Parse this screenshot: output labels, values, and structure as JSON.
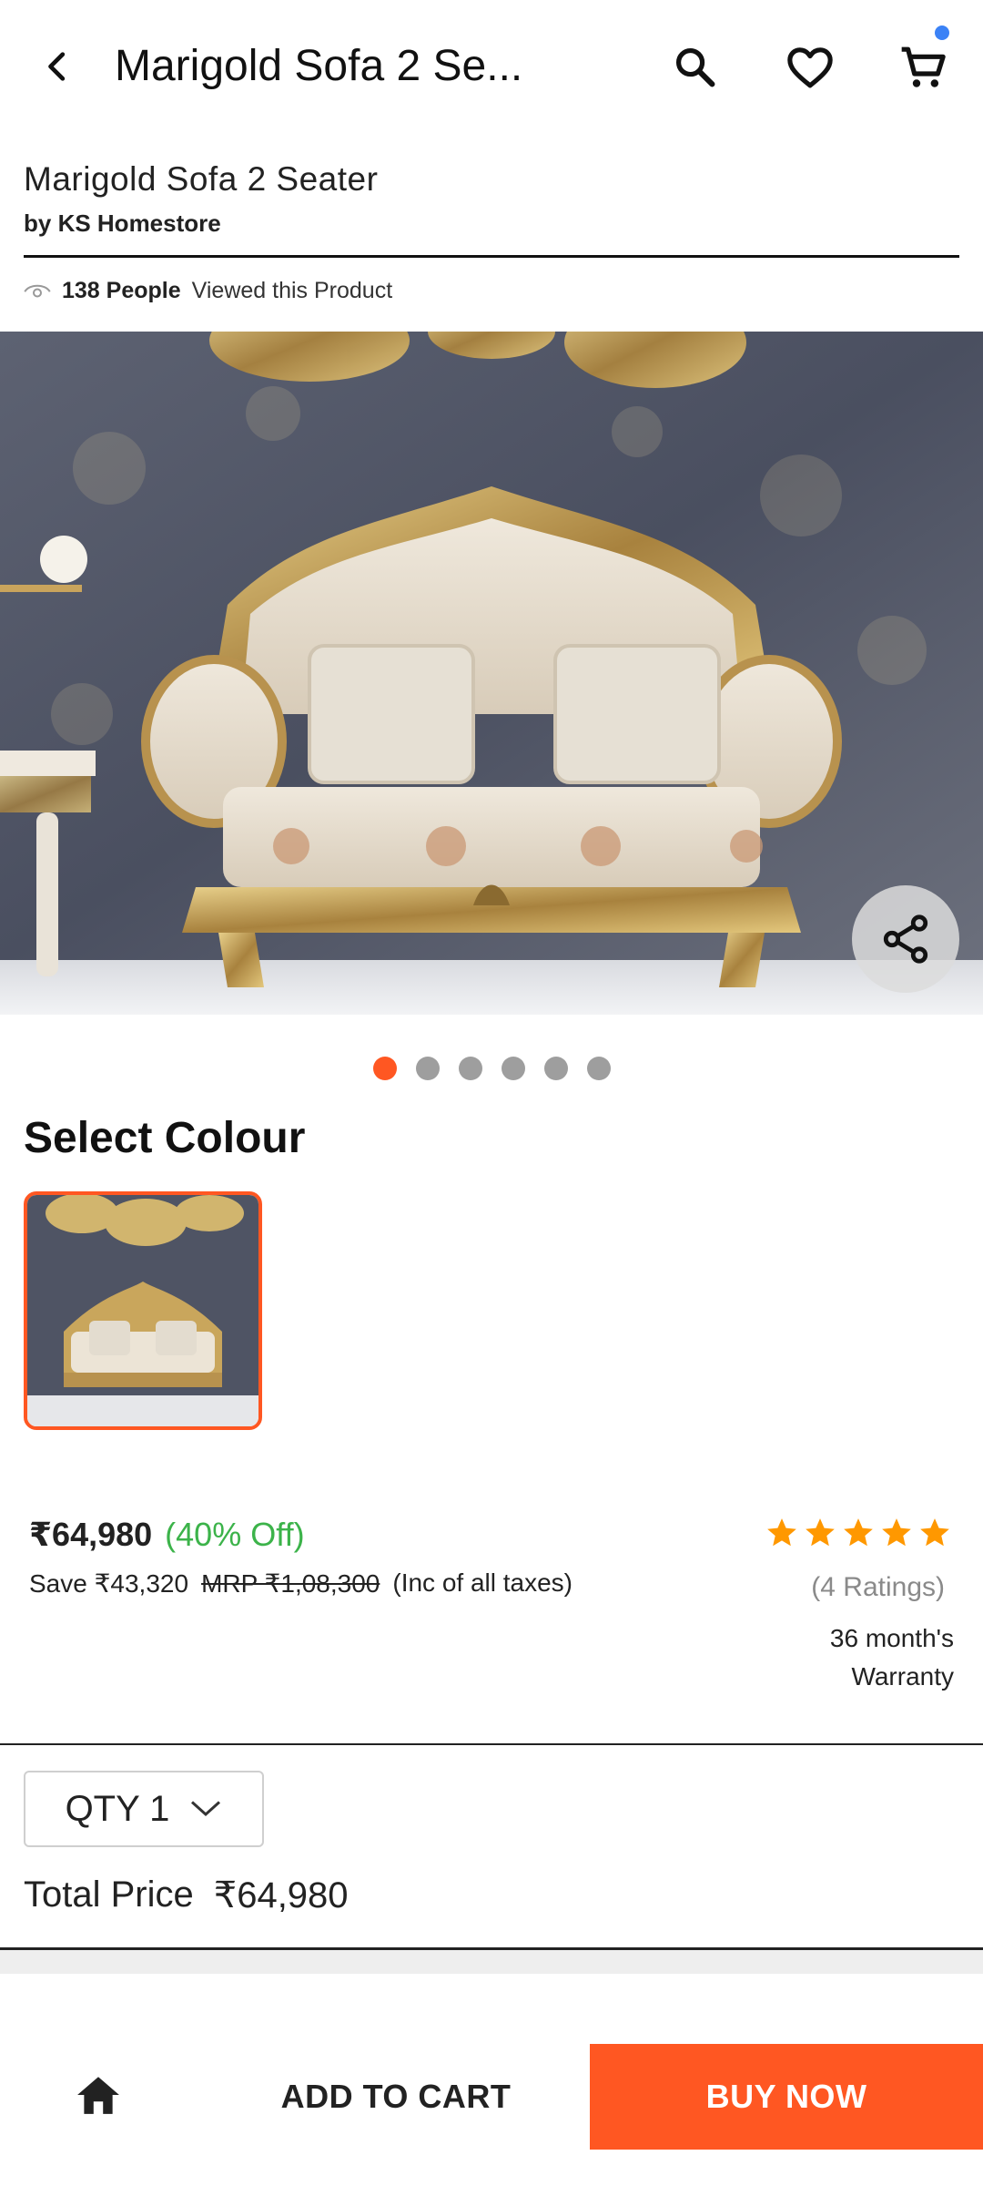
{
  "appbar": {
    "title": "Marigold Sofa 2 Se...",
    "icons": [
      "back-icon",
      "search-icon",
      "heart-icon",
      "cart-icon"
    ]
  },
  "product": {
    "name": "Marigold Sofa 2 Seater",
    "brand": "by KS Homestore",
    "views_count": "138 People",
    "views_text": "Viewed this Product",
    "image_count": 6,
    "active_image_index": 0
  },
  "colour": {
    "title": "Select Colour"
  },
  "pricing": {
    "price": "₹64,980",
    "discount": "(40% Off)",
    "save": "Save ₹43,320",
    "mrp": "MRP ₹1,08,300",
    "tax_note": "(Inc of all taxes)",
    "rating_stars": 5,
    "ratings": "(4 Ratings)",
    "warranty": "36 month's Warranty"
  },
  "quantity": {
    "label": "QTY 1",
    "total_label": "Total Price",
    "total_value": "₹64,980"
  },
  "bottom_bar": {
    "add_to_cart": "ADD TO CART",
    "buy_now": "BUY NOW"
  },
  "colors": {
    "accent": "#ff5722",
    "discount_green": "#3cb34a",
    "star": "#ff9800",
    "notification_dot": "#3b82f6"
  }
}
